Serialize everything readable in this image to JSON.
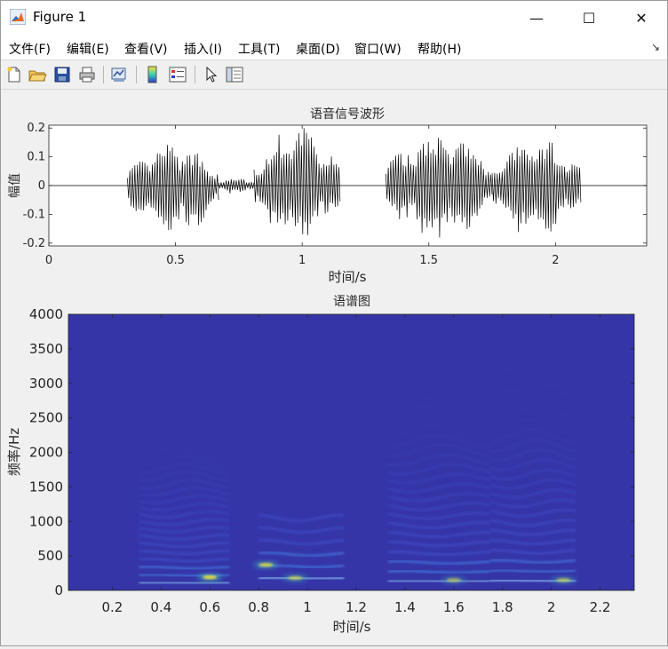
{
  "window": {
    "title": "Figure 1",
    "controls": {
      "minimize": "—",
      "maximize": "☐",
      "close": "✕"
    }
  },
  "menu": [
    "文件(F)",
    "编辑(E)",
    "查看(V)",
    "插入(I)",
    "工具(T)",
    "桌面(D)",
    "窗口(W)",
    "帮助(H)"
  ],
  "toolbar": [
    "new-figure-icon",
    "open-file-icon",
    "save-icon",
    "print-icon",
    "link-plot-icon",
    "insert-colorbar-icon",
    "insert-legend-icon",
    "edit-plot-cursor-icon",
    "property-inspector-icon"
  ],
  "chart_data": [
    {
      "type": "line",
      "title": "语音信号波形",
      "xlabel": "时间/s",
      "ylabel": "幅值",
      "xlim": [
        0,
        2.36
      ],
      "ylim": [
        -0.21,
        0.21
      ],
      "x_ticks": [
        0,
        0.5,
        1,
        1.5,
        2
      ],
      "x_tick_labels": [
        "0",
        "0.5",
        "1",
        "1.5",
        "2"
      ],
      "y_ticks": [
        -0.2,
        -0.1,
        0,
        0.1,
        0.2
      ],
      "y_tick_labels": [
        "-0.2",
        "-0.1",
        "0",
        "0.1",
        "0.2"
      ],
      "color": "#000000",
      "envelope_segments": [
        {
          "start": 0.31,
          "end": 0.67,
          "peak_max": 0.15,
          "peak_min": -0.19
        },
        {
          "start": 0.67,
          "end": 0.81,
          "peak_max": 0.03,
          "peak_min": -0.03
        },
        {
          "start": 0.81,
          "end": 1.15,
          "peak_max": 0.21,
          "peak_min": -0.2
        },
        {
          "start": 1.33,
          "end": 1.75,
          "peak_max": 0.2,
          "peak_min": -0.21
        },
        {
          "start": 1.75,
          "end": 2.1,
          "peak_max": 0.17,
          "peak_min": -0.19
        }
      ]
    },
    {
      "type": "heatmap",
      "title": "语谱图",
      "xlabel": "时间/s",
      "ylabel": "频率/Hz",
      "xlim": [
        0.02,
        2.34
      ],
      "ylim": [
        0,
        4000
      ],
      "x_ticks": [
        0.2,
        0.4,
        0.6,
        0.8,
        1,
        1.2,
        1.4,
        1.6,
        1.8,
        2,
        2.2
      ],
      "x_tick_labels": [
        "0.2",
        "0.4",
        "0.6",
        "0.8",
        "1",
        "1.2",
        "1.4",
        "1.6",
        "1.8",
        "2",
        "2.2"
      ],
      "y_ticks": [
        0,
        500,
        1000,
        1500,
        2000,
        2500,
        3000,
        3500,
        4000
      ],
      "y_tick_labels": [
        "0",
        "500",
        "1000",
        "1500",
        "2000",
        "2500",
        "3000",
        "3500",
        "4000"
      ],
      "background_color": "#3535a8",
      "harmonic_tracks": [
        {
          "start": 0.31,
          "end": 0.68,
          "f0": 110,
          "harmonics": 18
        },
        {
          "start": 0.8,
          "end": 1.15,
          "f0": 175,
          "harmonics": 6
        },
        {
          "start": 1.33,
          "end": 1.75,
          "f0": 135,
          "harmonics": 20
        },
        {
          "start": 1.75,
          "end": 2.1,
          "f0": 140,
          "harmonics": 22
        }
      ],
      "hotspots": [
        {
          "t": 0.6,
          "f": 190,
          "level": 1.0
        },
        {
          "t": 0.83,
          "f": 370,
          "level": 0.85
        },
        {
          "t": 0.95,
          "f": 180,
          "level": 0.7
        },
        {
          "t": 1.6,
          "f": 150,
          "level": 0.6
        },
        {
          "t": 2.05,
          "f": 150,
          "level": 0.65
        }
      ]
    }
  ]
}
